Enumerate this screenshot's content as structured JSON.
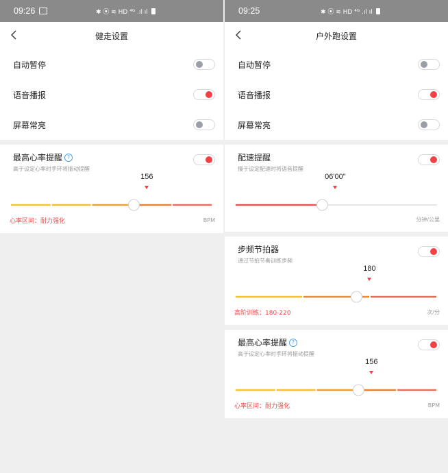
{
  "left": {
    "status": {
      "time": "09:26",
      "icons": "✱ ⦿ ≋ HD ⁴ᴳ .ıl ıl"
    },
    "nav": {
      "title": "健走设置"
    },
    "toggles": [
      {
        "label": "自动暂停",
        "on": false
      },
      {
        "label": "语音播报",
        "on": true
      },
      {
        "label": "屏幕常亮",
        "on": false
      }
    ],
    "sections": [
      {
        "title": "最高心率提醒",
        "help": true,
        "subtitle": "高于设定心率时手环将振动提醒",
        "on": true,
        "value": "156",
        "position": 0.61,
        "zone": "心率区间：耐力强化",
        "unit": "BPM",
        "track": {
          "type": "zones",
          "colors": [
            "#f5c62a",
            "#f3bf2b",
            "#f0a02e",
            "#ea8033",
            "#eb6c5e"
          ]
        }
      }
    ]
  },
  "right": {
    "status": {
      "time": "09:25",
      "icons": "✱ ⦿ ≋ HD ⁴ᴳ .ıl ıl"
    },
    "nav": {
      "title": "户外跑设置"
    },
    "toggles": [
      {
        "label": "自动暂停",
        "on": false
      },
      {
        "label": "语音播报",
        "on": true
      },
      {
        "label": "屏幕常亮",
        "on": false
      }
    ],
    "sections": [
      {
        "title": "配速提醒",
        "help": false,
        "subtitle": "慢于设定配速时将语音提醒",
        "on": true,
        "value": "06'00\"",
        "position": 0.43,
        "zone": "",
        "unit": "分钟/公里",
        "track": {
          "type": "fill",
          "colors": [
            "#ef5350",
            "#e6e6e6"
          ]
        }
      },
      {
        "title": "步频节拍器",
        "help": false,
        "subtitle": "通过节拍节奏训练步频",
        "on": true,
        "value": "180",
        "position": 0.6,
        "zone": "高阶训练：180-220",
        "unit": "次/分",
        "track": {
          "type": "zones",
          "colors": [
            "#f5c62a",
            "#ef8a35",
            "#eb6a5a"
          ]
        }
      },
      {
        "title": "最高心率提醒",
        "help": true,
        "subtitle": "高于设定心率时手环将振动提醒",
        "on": true,
        "value": "156",
        "position": 0.61,
        "zone": "心率区间：耐力强化",
        "unit": "BPM",
        "track": {
          "type": "zones",
          "colors": [
            "#f5c62a",
            "#f3bf2b",
            "#f0a02e",
            "#ea8033",
            "#eb6c5e"
          ]
        }
      }
    ]
  }
}
